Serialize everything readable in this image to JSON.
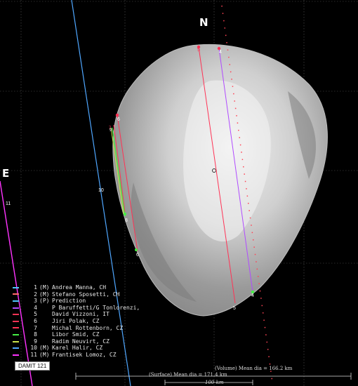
{
  "directions": {
    "north": "N",
    "east": "E"
  },
  "legend_title": "",
  "observers": [
    {
      "id": "1",
      "flag": "(M)",
      "name": "Andrea Manna, CH",
      "color": "#4fc3ff",
      "chord_label": "1"
    },
    {
      "id": "2",
      "flag": "(M)",
      "name": "Stefano Sposetti, CH",
      "color": "#ff6a6a",
      "chord_label": "2"
    },
    {
      "id": "3",
      "flag": "(P)",
      "name": "Prediction",
      "color": "#4fc3ff",
      "chord_label": "3"
    },
    {
      "id": "4",
      "flag": "",
      "name": "P Baruffetti/G Tonlorenzi,",
      "color": "#b04bff",
      "chord_label": "4"
    },
    {
      "id": "5",
      "flag": "",
      "name": "David Vizzoni, IT",
      "color": "#ff3355",
      "chord_label": "5"
    },
    {
      "id": "6",
      "flag": "",
      "name": "Jiri Polak, CZ",
      "color": "#ff3355",
      "chord_label": "6"
    },
    {
      "id": "7",
      "flag": "",
      "name": "Michal Rottenborn, CZ",
      "color": "#ff3355",
      "chord_label": "7"
    },
    {
      "id": "8",
      "flag": "",
      "name": "Libor Smid, CZ",
      "color": "#44ee44",
      "chord_label": "8"
    },
    {
      "id": "9",
      "flag": "",
      "name": "Radim Neuvirt, CZ",
      "color": "#c9e34a",
      "chord_label": "9"
    },
    {
      "id": "10",
      "flag": "(M)",
      "name": "Karel Halir, CZ",
      "color": "#4fa7ff",
      "chord_label": "10"
    },
    {
      "id": "11",
      "flag": "(M)",
      "name": "Frantisek Lomoz, CZ",
      "color": "#ff33ff",
      "chord_label": "11"
    }
  ],
  "model_tag": "DAMIT 121",
  "surface_text": "(Surface) Mean dia = 171.4 km",
  "volume_text": "(Volume) Mean dia = 166.2 km",
  "scale_label": "100 km",
  "chart_data": {
    "type": "scatter",
    "title": "",
    "xlabel": "",
    "ylabel": "",
    "grid": true,
    "legend_placement": "bottom-left",
    "chords": [
      {
        "id": "4",
        "start_label": "4",
        "end_label": "4"
      },
      {
        "id": "5",
        "start_label": "5",
        "end_label": "5"
      },
      {
        "id": "6",
        "start_label": "6",
        "end_label": "6"
      },
      {
        "id": "7",
        "start_label": "7",
        "end_label": "7"
      },
      {
        "id": "8",
        "start_label": "8",
        "end_label": "8"
      },
      {
        "id": "9",
        "start_label": "9",
        "end_label": "9"
      },
      {
        "id": "10",
        "start_label": "10",
        "end_label": ""
      },
      {
        "id": "11",
        "start_label": "11",
        "end_label": ""
      }
    ]
  }
}
